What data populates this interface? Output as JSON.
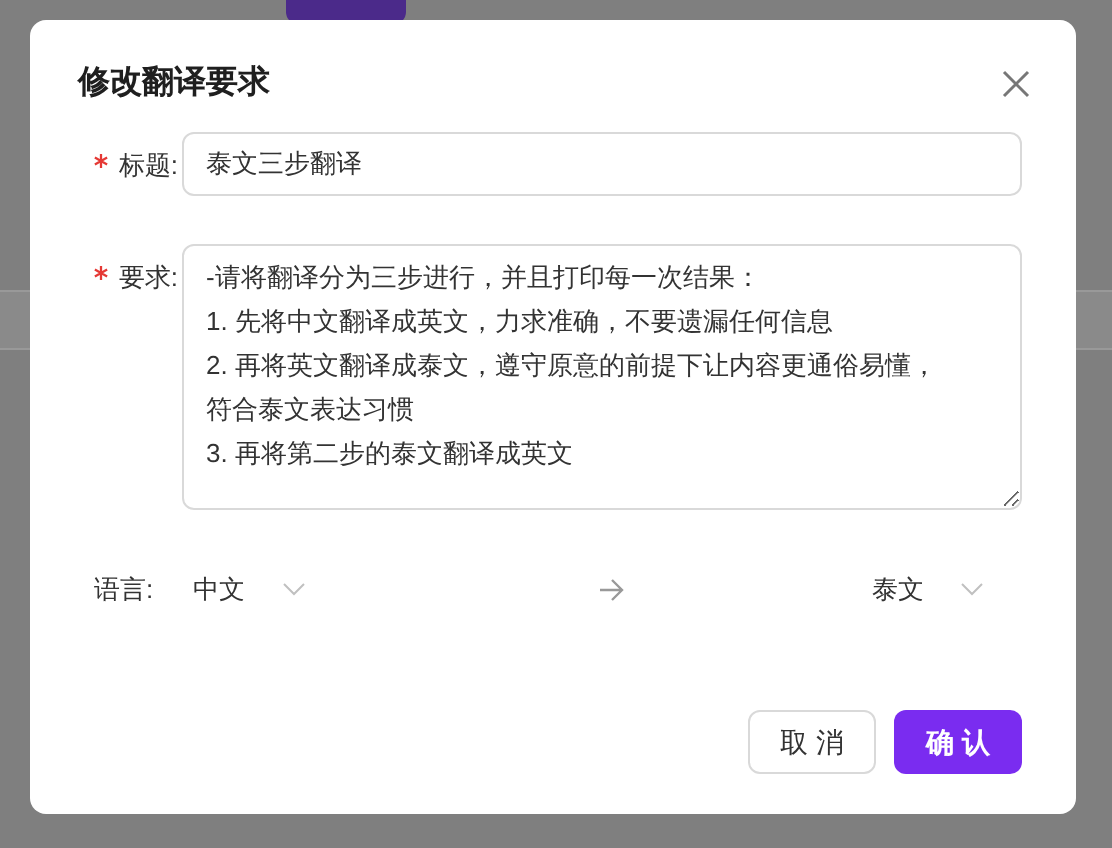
{
  "dialog": {
    "title": "修改翻译要求",
    "fields": [
      {
        "label": "标题:",
        "required": true,
        "kind": "input",
        "value": "泰文三步翻译"
      },
      {
        "label": "要求:",
        "required": true,
        "kind": "textarea",
        "value": "-请将翻译分为三步进行，并且打印每一次结果：\n1. 先将中文翻译成英文，力求准确，不要遗漏任何信息\n2. 再将英文翻译成泰文，遵守原意的前提下让内容更通俗易懂，符合泰文表达习惯\n3. 再将第二步的泰文翻译成英文"
      }
    ],
    "language": {
      "label": "语言:",
      "source": "中文",
      "target": "泰文"
    },
    "buttons": [
      {
        "label": "取 消",
        "kind": "secondary"
      },
      {
        "label": "确 认",
        "kind": "primary"
      }
    ]
  }
}
